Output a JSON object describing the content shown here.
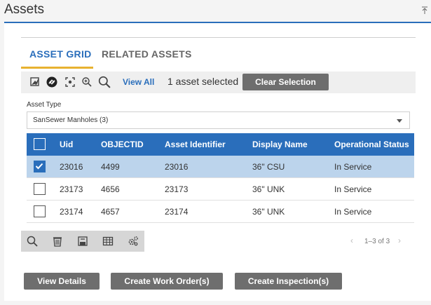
{
  "header": {
    "title": "Assets"
  },
  "tabs": [
    {
      "label": "ASSET GRID",
      "active": true
    },
    {
      "label": "RELATED ASSETS",
      "active": false
    }
  ],
  "toolbar": {
    "icons": [
      "image-edit-icon",
      "link-toggle-icon",
      "select-extent-icon",
      "zoom-in-icon",
      "search-icon"
    ],
    "view_all_label": "View All",
    "selection_text": "1 asset selected",
    "clear_label": "Clear Selection"
  },
  "asset_type": {
    "label": "Asset Type",
    "value": "SanSewer Manholes (3)"
  },
  "grid": {
    "columns": [
      "Uid",
      "OBJECTID",
      "Asset Identifier",
      "Display Name",
      "Operational Status"
    ],
    "rows": [
      {
        "uid": "23016",
        "objectid": "4499",
        "asset_id": "23016",
        "display_name": "36\" CSU",
        "status": "In Service",
        "checked": true
      },
      {
        "uid": "23173",
        "objectid": "4656",
        "asset_id": "23173",
        "display_name": "36\" UNK",
        "status": "In Service",
        "checked": false
      },
      {
        "uid": "23174",
        "objectid": "4657",
        "asset_id": "23174",
        "display_name": "36\" UNK",
        "status": "In Service",
        "checked": false
      }
    ]
  },
  "grid_footer": {
    "icons": [
      "search-icon",
      "delete-icon",
      "save-icon",
      "table-icon",
      "settings-icon"
    ],
    "pager_text": "1–3 of 3"
  },
  "actions": {
    "view_details": "View Details",
    "create_work_orders": "Create Work Order(s)",
    "create_inspections": "Create Inspection(s)"
  },
  "colors": {
    "accent": "#2a6ebb",
    "tab_underline": "#e8b230",
    "selected_row": "#bcd4ec",
    "button": "#6e6e6e"
  }
}
